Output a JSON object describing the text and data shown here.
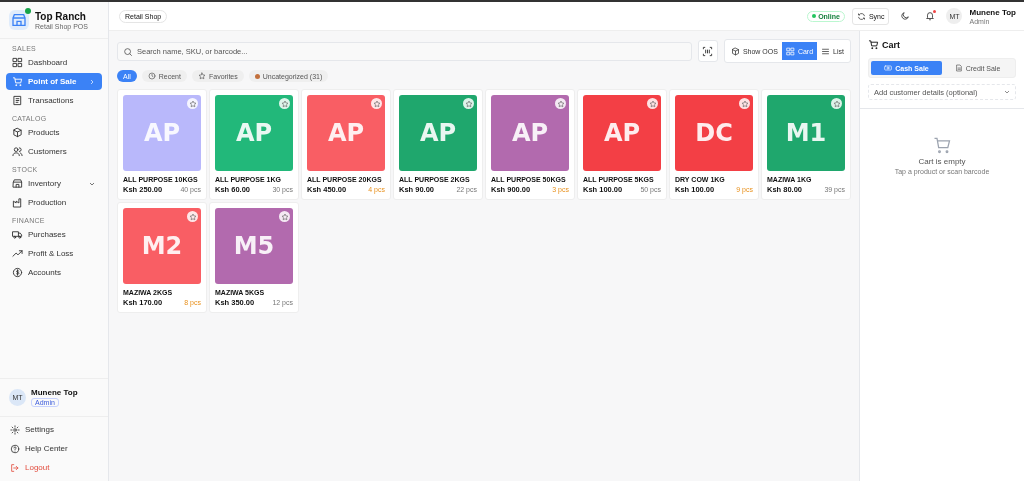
{
  "brand": {
    "name": "Top Ranch",
    "subtitle": "Retail Shop POS",
    "online": true
  },
  "sidebar": {
    "sections": [
      {
        "title": "SALES",
        "items": [
          {
            "label": "Dashboard",
            "selected": false
          },
          {
            "label": "Point of Sale",
            "selected": true
          },
          {
            "label": "Transactions",
            "selected": false
          }
        ]
      },
      {
        "title": "CATALOG",
        "items": [
          {
            "label": "Products",
            "selected": false
          },
          {
            "label": "Customers",
            "selected": false
          }
        ]
      },
      {
        "title": "STOCK",
        "items": [
          {
            "label": "Inventory",
            "selected": false,
            "expandable": true
          },
          {
            "label": "Production",
            "selected": false
          }
        ]
      },
      {
        "title": "FINANCE",
        "items": [
          {
            "label": "Purchases",
            "selected": false
          },
          {
            "label": "Profit & Loss",
            "selected": false
          },
          {
            "label": "Accounts",
            "selected": false
          }
        ]
      }
    ],
    "user": {
      "initials": "MT",
      "name": "Munene Top",
      "role": "Admin"
    },
    "footer": [
      {
        "label": "Settings",
        "kind": "normal"
      },
      {
        "label": "Help Center",
        "kind": "normal"
      },
      {
        "label": "Logout",
        "kind": "danger"
      }
    ]
  },
  "topbar": {
    "shop": "Retail Shop",
    "status": "Online",
    "sync": "Sync",
    "notifications": true,
    "user": {
      "initials": "MT",
      "name": "Munene Top",
      "role": "Admin"
    }
  },
  "search": {
    "placeholder": "Search name, SKU, or barcode..."
  },
  "view_toggle": [
    {
      "label": "Show OOS",
      "selected": false
    },
    {
      "label": "Card",
      "selected": true
    },
    {
      "label": "List",
      "selected": false
    }
  ],
  "filters": [
    {
      "label": "All",
      "selected": true
    },
    {
      "label": "Recent",
      "selected": false
    },
    {
      "label": "Favorites",
      "selected": false
    },
    {
      "label": "Uncategorized (31)",
      "selected": false
    }
  ],
  "products": [
    {
      "initials": "AP",
      "name": "ALL PURPOSE 10KGS",
      "price": "Ksh 250.00",
      "stock": "40 pcs",
      "low": false,
      "color": "#b9b8fb"
    },
    {
      "initials": "AP",
      "name": "ALL PURPOSE 1KG",
      "price": "Ksh 60.00",
      "stock": "30 pcs",
      "low": false,
      "color": "#22b87a"
    },
    {
      "initials": "AP",
      "name": "ALL PURPOSE 20KGS",
      "price": "Ksh 450.00",
      "stock": "4 pcs",
      "low": true,
      "color": "#f95e64"
    },
    {
      "initials": "AP",
      "name": "ALL PURPOSE 2KGS",
      "price": "Ksh 90.00",
      "stock": "22 pcs",
      "low": false,
      "color": "#1fa76d"
    },
    {
      "initials": "AP",
      "name": "ALL PURPOSE 50KGS",
      "price": "Ksh 900.00",
      "stock": "3 pcs",
      "low": true,
      "color": "#b26aae"
    },
    {
      "initials": "AP",
      "name": "ALL PURPOSE 5KGS",
      "price": "Ksh 100.00",
      "stock": "50 pcs",
      "low": false,
      "color": "#f33f45"
    },
    {
      "initials": "DC",
      "name": "DRY COW 1KG",
      "price": "Ksh 100.00",
      "stock": "9 pcs",
      "low": true,
      "color": "#f33f45"
    },
    {
      "initials": "M1",
      "name": "MAZIWA 1KG",
      "price": "Ksh 80.00",
      "stock": "39 pcs",
      "low": false,
      "color": "#1fa76d"
    },
    {
      "initials": "M2",
      "name": "MAZIWA 2KGS",
      "price": "Ksh 170.00",
      "stock": "8 pcs",
      "low": true,
      "color": "#f95e64"
    },
    {
      "initials": "M5",
      "name": "MAZIWA 5KGS",
      "price": "Ksh 350.00",
      "stock": "12 pcs",
      "low": false,
      "color": "#b26aae"
    }
  ],
  "cart": {
    "title": "Cart",
    "sale_types": [
      {
        "label": "Cash Sale",
        "selected": true
      },
      {
        "label": "Credit Sale",
        "selected": false
      }
    ],
    "customer": {
      "placeholder": "Add customer details (optional)"
    },
    "empty_title": "Cart is empty",
    "empty_hint": "Tap a product or scan barcode"
  }
}
